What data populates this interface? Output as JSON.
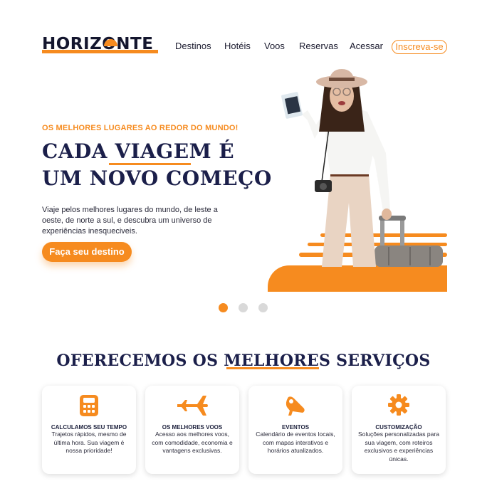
{
  "brand": {
    "name": "HORIZONTE",
    "accent": "#f68b1f",
    "navy": "#1b1f4a"
  },
  "nav": {
    "items": [
      "Destinos",
      "Hotéis",
      "Voos",
      "Reservas",
      "Acessar"
    ],
    "signup": "Inscreva-se"
  },
  "hero": {
    "eyebrow": "OS MELHORES LUGARES AO REDOR DO MUNDO!",
    "headline_line1": "CADA VIAGEM É",
    "headline_line2": "UM NOVO COMEÇO",
    "description": "Viaje pelos melhores lugares do mundo, de leste a oeste, de norte a sul, e descubra um universo de experiências inesqueciveis.",
    "cta": "Faça seu destino",
    "image": "woman-traveler-with-suitcase-photo"
  },
  "carousel": {
    "slides": 3,
    "active": 1
  },
  "services": {
    "title": "OFERECEMOS OS MELHORES SERVIÇOS",
    "cards": [
      {
        "icon": "calculator-icon",
        "title": "CALCULAMOS SEU TEMPO",
        "text": "Trajetos rápidos, mesmo de última hora. Sua viagem é nossa prioridade!"
      },
      {
        "icon": "airplane-icon",
        "title": "OS MELHORES VOOS",
        "text": "Acesso aos melhores voos, com comodidade, economia e vantagens exclusivas."
      },
      {
        "icon": "megaphone-icon",
        "title": "EVENTOS",
        "text": "Calendário de eventos locais, com mapas interativos e horários atualizados."
      },
      {
        "icon": "gear-icon",
        "title": "CUSTOMIZAÇÃO",
        "text": "Soluções personalizadas para sua viagem, com roteiros exclusivos e experiências únicas."
      }
    ]
  }
}
